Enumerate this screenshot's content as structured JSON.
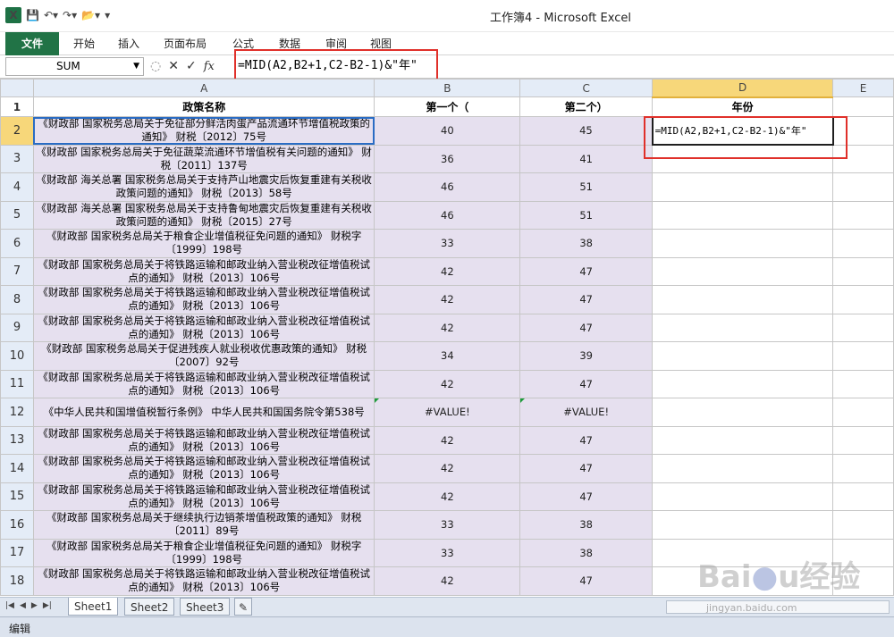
{
  "window": {
    "title": "工作簿4 - Microsoft Excel"
  },
  "ribbon": {
    "file": "文件",
    "tabs": [
      "开始",
      "插入",
      "页面布局",
      "公式",
      "数据",
      "审阅",
      "视图"
    ]
  },
  "formula_bar": {
    "name_box": "SUM",
    "formula": "=MID(A2,B2+1,C2-B2-1)&\"年\""
  },
  "columns": [
    "A",
    "B",
    "C",
    "D",
    "E"
  ],
  "header_row": {
    "a": "政策名称",
    "b": "第一个（",
    "c": "第二个）",
    "d": "年份"
  },
  "rows": [
    {
      "n": "2",
      "a": "《财政部 国家税务总局关于免征部分鲜活肉蛋产品流通环节增值税政策的通知》 财税〔2012〕75号",
      "b": "40",
      "c": "45",
      "d": "=MID(A2,B2+1,C2-B2-1)&\"年\""
    },
    {
      "n": "3",
      "a": "《财政部 国家税务总局关于免征蔬菜流通环节增值税有关问题的通知》 财税〔2011〕137号",
      "b": "36",
      "c": "41",
      "d": ""
    },
    {
      "n": "4",
      "a": "《财政部 海关总署 国家税务总局关于支持芦山地震灾后恢复重建有关税收政策问题的通知》 财税〔2013〕58号",
      "b": "46",
      "c": "51",
      "d": ""
    },
    {
      "n": "5",
      "a": "《财政部 海关总署 国家税务总局关于支持鲁甸地震灾后恢复重建有关税收政策问题的通知》 财税〔2015〕27号",
      "b": "46",
      "c": "51",
      "d": ""
    },
    {
      "n": "6",
      "a": "《财政部 国家税务总局关于粮食企业增值税征免问题的通知》 财税字〔1999〕198号",
      "b": "33",
      "c": "38",
      "d": ""
    },
    {
      "n": "7",
      "a": "《财政部 国家税务总局关于将铁路运输和邮政业纳入营业税改征增值税试点的通知》 财税〔2013〕106号",
      "b": "42",
      "c": "47",
      "d": ""
    },
    {
      "n": "8",
      "a": "《财政部 国家税务总局关于将铁路运输和邮政业纳入营业税改征增值税试点的通知》 财税〔2013〕106号",
      "b": "42",
      "c": "47",
      "d": ""
    },
    {
      "n": "9",
      "a": "《财政部 国家税务总局关于将铁路运输和邮政业纳入营业税改征增值税试点的通知》 财税〔2013〕106号",
      "b": "42",
      "c": "47",
      "d": ""
    },
    {
      "n": "10",
      "a": "《财政部 国家税务总局关于促进残疾人就业税收优惠政策的通知》 财税〔2007〕92号",
      "b": "34",
      "c": "39",
      "d": ""
    },
    {
      "n": "11",
      "a": "《财政部 国家税务总局关于将铁路运输和邮政业纳入营业税改征增值税试点的通知》 财税〔2013〕106号",
      "b": "42",
      "c": "47",
      "d": ""
    },
    {
      "n": "12",
      "a": "《中华人民共和国增值税暂行条例》 中华人民共和国国务院令第538号",
      "b": "#VALUE!",
      "c": "#VALUE!",
      "d": ""
    },
    {
      "n": "13",
      "a": "《财政部 国家税务总局关于将铁路运输和邮政业纳入营业税改征增值税试点的通知》 财税〔2013〕106号",
      "b": "42",
      "c": "47",
      "d": ""
    },
    {
      "n": "14",
      "a": "《财政部 国家税务总局关于将铁路运输和邮政业纳入营业税改征增值税试点的通知》 财税〔2013〕106号",
      "b": "42",
      "c": "47",
      "d": ""
    },
    {
      "n": "15",
      "a": "《财政部 国家税务总局关于将铁路运输和邮政业纳入营业税改征增值税试点的通知》 财税〔2013〕106号",
      "b": "42",
      "c": "47",
      "d": ""
    },
    {
      "n": "16",
      "a": "《财政部 国家税务总局关于继续执行边销茶增值税政策的通知》 财税〔2011〕89号",
      "b": "33",
      "c": "38",
      "d": ""
    },
    {
      "n": "17",
      "a": "《财政部 国家税务总局关于粮食企业增值税征免问题的通知》 财税字〔1999〕198号",
      "b": "33",
      "c": "38",
      "d": ""
    },
    {
      "n": "18",
      "a": "《财政部 国家税务总局关于将铁路运输和邮政业纳入营业税改征增值税试点的通知》 财税〔2013〕106号",
      "b": "42",
      "c": "47",
      "d": ""
    }
  ],
  "sheets": [
    "Sheet1",
    "Sheet2",
    "Sheet3"
  ],
  "status": {
    "mode": "编辑"
  },
  "watermark": {
    "logo": "Baidu经验",
    "url": "jingyan.baidu.com"
  }
}
